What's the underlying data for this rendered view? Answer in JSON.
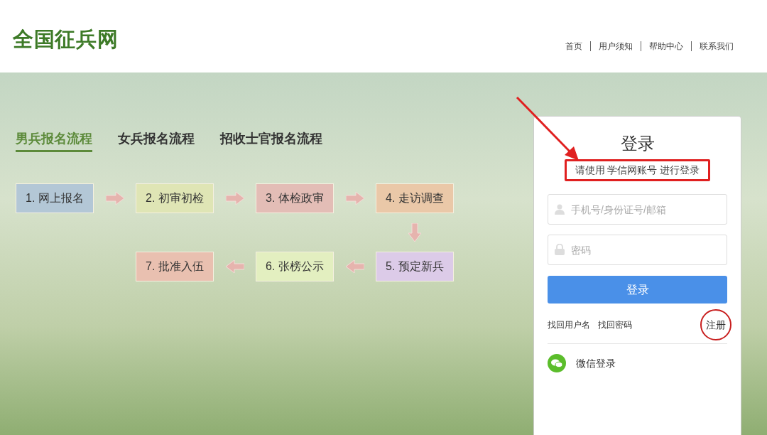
{
  "header": {
    "logo": "全国征兵网",
    "nav": [
      {
        "label": "首页"
      },
      {
        "label": "用户须知"
      },
      {
        "label": "帮助中心"
      },
      {
        "label": "联系我们"
      }
    ]
  },
  "process_tabs": [
    {
      "label": "男兵报名流程",
      "selected": true
    },
    {
      "label": "女兵报名流程",
      "selected": false
    },
    {
      "label": "招收士官报名流程",
      "selected": false
    }
  ],
  "steps_row_1": [
    {
      "label": "1. 网上报名",
      "color": "#b3c7d6"
    },
    {
      "label": "2. 初审初检",
      "color": "#dfe5b5"
    },
    {
      "label": "3. 体检政审",
      "color": "#e3bdb6"
    },
    {
      "label": "4. 走访调查",
      "color": "#eac8a8"
    }
  ],
  "steps_row_2": [
    {
      "label": "7. 批准入伍",
      "color": "#e9c0b0"
    },
    {
      "label": "6. 张榜公示",
      "color": "#e3efc0"
    },
    {
      "label": "5. 预定新兵",
      "color": "#dccbe8"
    }
  ],
  "login": {
    "title": "登录",
    "hint": "请使用 学信网账号 进行登录",
    "username": {
      "placeholder": "手机号/身份证号/邮箱"
    },
    "password": {
      "placeholder": "密码"
    },
    "submit": "登录",
    "links": [
      "找回用户名",
      "找回密码"
    ],
    "register": "注册",
    "wechat": "微信登录"
  }
}
